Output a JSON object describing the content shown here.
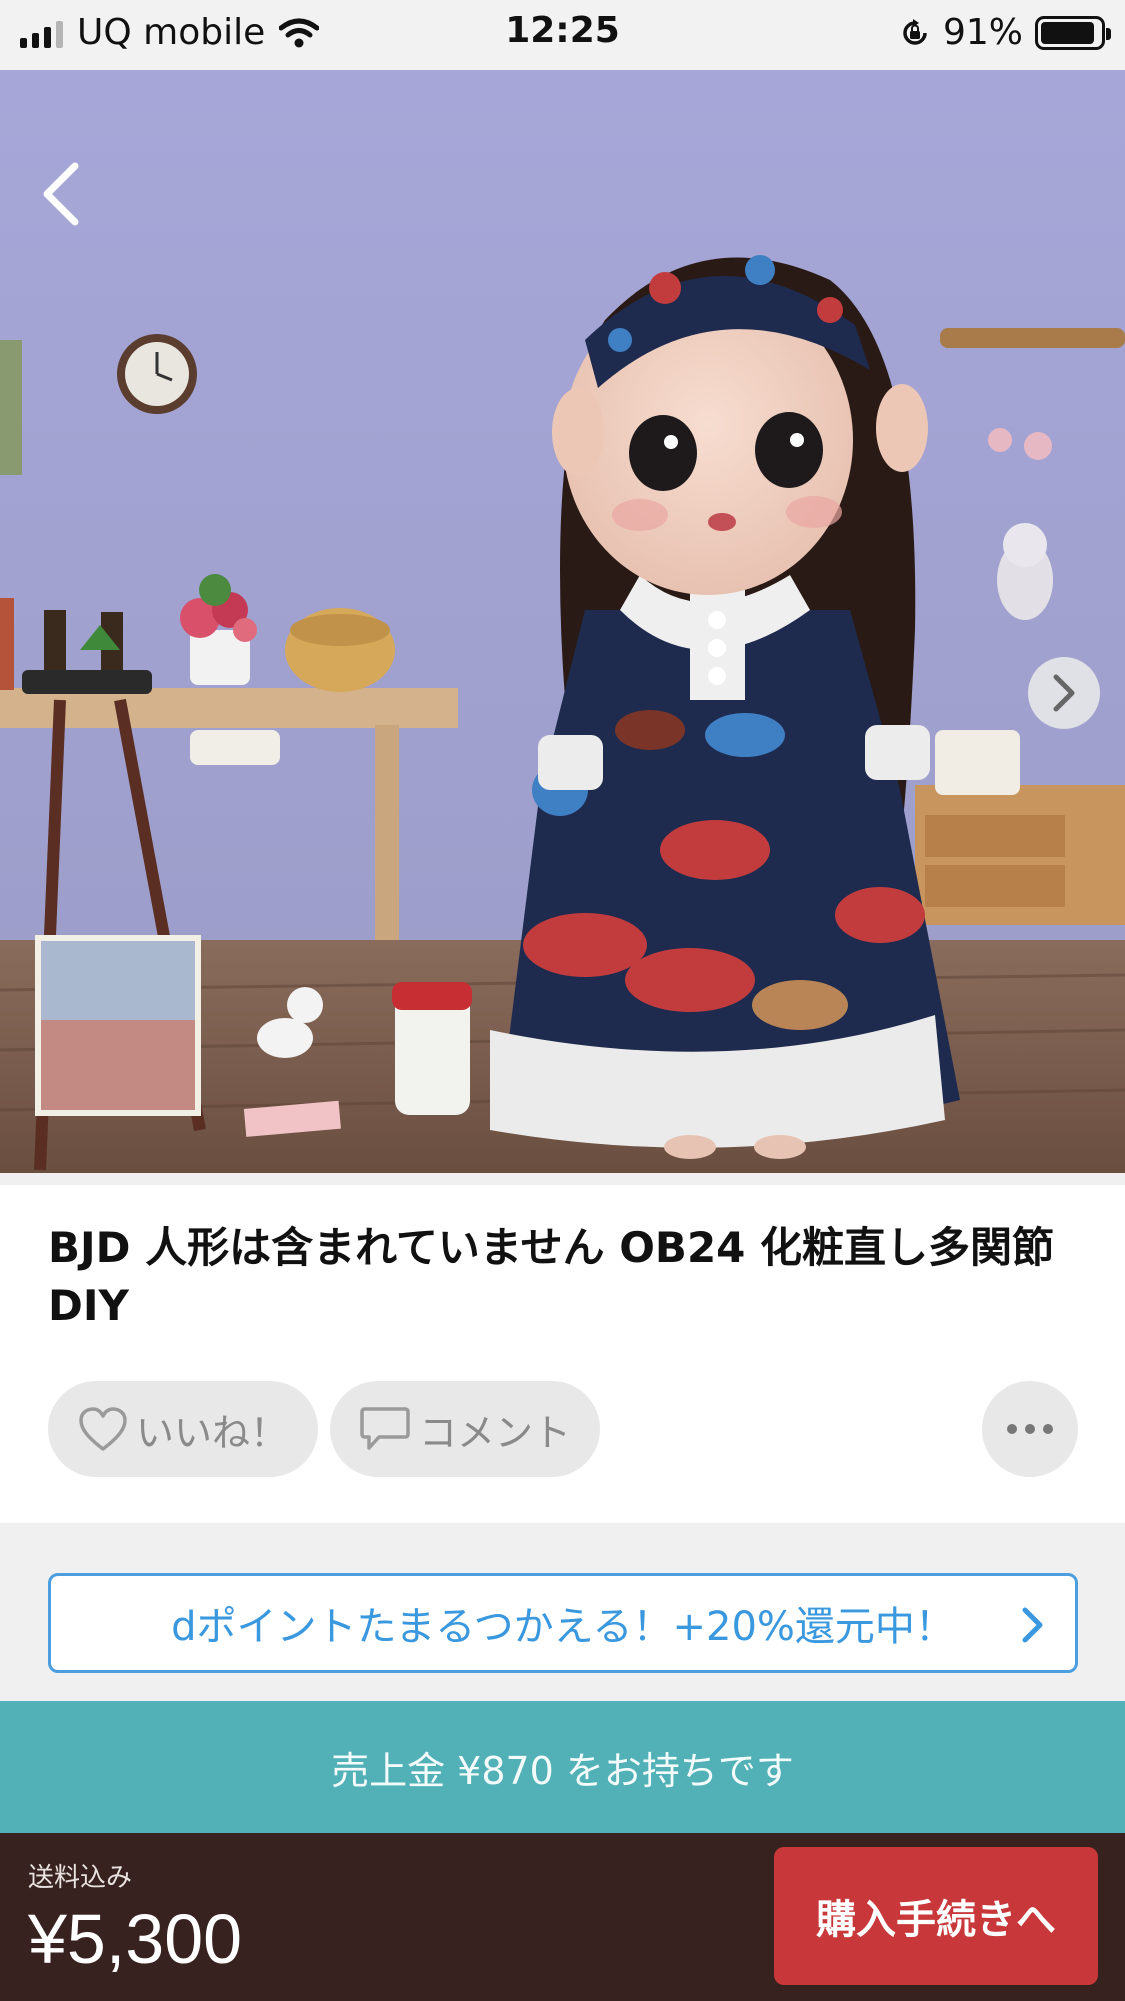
{
  "status_bar": {
    "carrier": "UQ mobile",
    "time": "12:25",
    "battery_percent": "91%",
    "battery_level": 0.91,
    "icons": [
      "cellular-signal-icon",
      "wifi-icon",
      "orientation-lock-icon",
      "battery-icon"
    ]
  },
  "photo": {
    "page_count": 4,
    "active_page": 1,
    "icons": [
      "back-chevron-icon",
      "next-chevron-icon"
    ]
  },
  "item": {
    "title": "BJD 人形は含まれていません OB24 化粧直し多関節 DIY"
  },
  "actions": {
    "like_label": "いいね！",
    "comment_label": "コメント",
    "icons": [
      "heart-icon",
      "speech-bubble-icon",
      "more-icon"
    ]
  },
  "dpoint_banner": {
    "text": "dポイントたまるつかえる！+20%還元中！",
    "icon": "chevron-right-icon",
    "color": "#3a98df"
  },
  "sales_balance": {
    "text": "売上金 ¥870 をお持ちです",
    "color": "#52b0b7"
  },
  "purchase_bar": {
    "shipping_label": "送料込み",
    "price": "¥5,300",
    "buy_label": "購入手続きへ",
    "buy_color": "#c8383a",
    "bar_color": "#372220"
  }
}
